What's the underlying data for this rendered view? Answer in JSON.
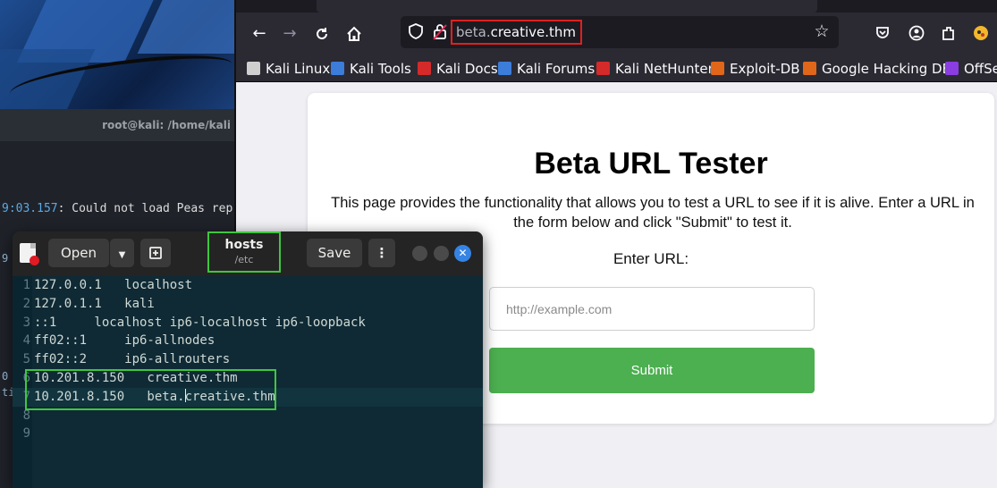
{
  "terminal": {
    "title": "root@kali: /home/kali",
    "log_timestamp": "9:03.157",
    "log_text": ": Could not load Peas rep",
    "fragments": [
      "9",
      "0",
      "ti"
    ]
  },
  "browser": {
    "url_subdomain": "beta.",
    "url_domain": "creative.thm",
    "bookmarks": [
      {
        "label": "Kali Linux",
        "icon_color": "#cfcfcf"
      },
      {
        "label": "Kali Tools",
        "icon_color": "#3c7dd9"
      },
      {
        "label": "Kali Docs",
        "icon_color": "#d42a2a"
      },
      {
        "label": "Kali Forums",
        "icon_color": "#3c7dd9"
      },
      {
        "label": "Kali NetHunter",
        "icon_color": "#d42a2a"
      },
      {
        "label": "Exploit-DB",
        "icon_color": "#e0661a"
      },
      {
        "label": "Google Hacking DB",
        "icon_color": "#e0661a"
      },
      {
        "label": "OffSe",
        "icon_color": "#8a3de0"
      }
    ]
  },
  "page": {
    "heading": "Beta URL Tester",
    "description": "This page provides the functionality that allows you to test a URL to see if it is alive. Enter a URL in the form below and click \"Submit\" to test it.",
    "label": "Enter URL:",
    "input_placeholder": "http://example.com",
    "submit_label": "Submit",
    "submit_color": "#4caf50"
  },
  "editor": {
    "open_label": "Open",
    "save_label": "Save",
    "file_name": "hosts",
    "file_path": "/etc",
    "lines": [
      {
        "n": "1",
        "text": "127.0.0.1   localhost"
      },
      {
        "n": "2",
        "text": "127.0.1.1   kali"
      },
      {
        "n": "3",
        "text": "::1     localhost ip6-localhost ip6-loopback"
      },
      {
        "n": "4",
        "text": "ff02::1     ip6-allnodes"
      },
      {
        "n": "5",
        "text": "ff02::2     ip6-allrouters"
      },
      {
        "n": "6",
        "text": "10.201.8.150   creative.thm"
      },
      {
        "n": "7",
        "text_before_caret": "10.201.8.150   beta.",
        "text_after_caret": "creative.thm"
      },
      {
        "n": "8",
        "text": ""
      },
      {
        "n": "9",
        "text": ""
      }
    ],
    "highlight_color": "#3ec73e"
  }
}
